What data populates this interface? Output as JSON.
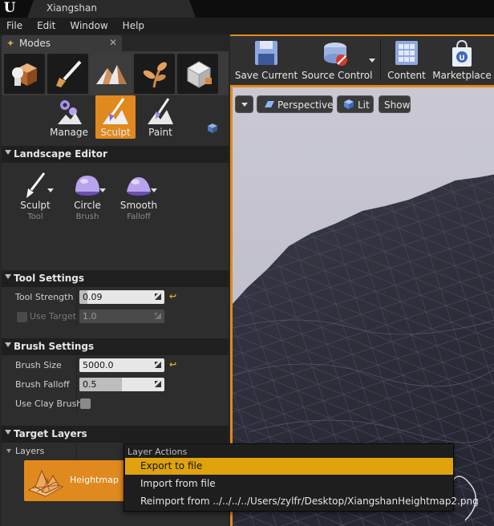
{
  "window": {
    "title": "Xiangshan"
  },
  "menubar": {
    "items": [
      "File",
      "Edit",
      "Window",
      "Help"
    ]
  },
  "modes_panel": {
    "tab_label": "Modes",
    "mode_icons": [
      "place-icon",
      "paint-icon",
      "landscape-icon",
      "foliage-icon",
      "geometry-icon"
    ],
    "active_mode": "landscape",
    "tool_modes": [
      {
        "label": "Manage",
        "icon": "manage-icon"
      },
      {
        "label": "Sculpt",
        "icon": "sculpt-icon",
        "active": true
      },
      {
        "label": "Paint",
        "icon": "paint-mode-icon"
      }
    ]
  },
  "landscape_editor": {
    "title": "Landscape Editor",
    "tools": [
      {
        "title": "Sculpt",
        "sub": "Tool"
      },
      {
        "title": "Circle",
        "sub": "Brush"
      },
      {
        "title": "Smooth",
        "sub": "Falloff"
      }
    ]
  },
  "tool_settings": {
    "title": "Tool Settings",
    "tool_strength": {
      "label": "Tool Strength",
      "value": "0.09",
      "fraction": 0.09
    },
    "use_target": {
      "label": "Use Target",
      "value": "1.0",
      "checked": false
    }
  },
  "brush_settings": {
    "title": "Brush Settings",
    "brush_size": {
      "label": "Brush Size",
      "value": "5000.0"
    },
    "brush_falloff": {
      "label": "Brush Falloff",
      "value": "0.5",
      "fraction": 0.5
    },
    "use_clay_brush": {
      "label": "Use Clay Brush",
      "checked": false
    }
  },
  "target_layers": {
    "title": "Target Layers",
    "layers_label": "Layers",
    "layer": {
      "name": "Heightmap"
    }
  },
  "toolbar": {
    "buttons": [
      {
        "label": "Save Current",
        "icon": "save-icon"
      },
      {
        "label": "Source Control",
        "icon": "source-control-icon"
      },
      {
        "label": "Content",
        "icon": "content-icon"
      },
      {
        "label": "Marketplace",
        "icon": "marketplace-icon"
      }
    ]
  },
  "viewport": {
    "perspective": "Perspective",
    "lit": "Lit",
    "show": "Show"
  },
  "context_menu": {
    "header": "Layer Actions",
    "items": [
      {
        "label": "Export to file",
        "highlighted": true
      },
      {
        "label": "Import from file"
      },
      {
        "label": "Reimport from ../../../../Users/zylfr/Desktop/XiangshanHeightmap2.png"
      }
    ]
  },
  "colors": {
    "accent_orange": "#e0891e",
    "menu_highlight": "#e0a30e",
    "panel_bg": "#2d2d2d",
    "section_header_bg": "#1f1f1f"
  }
}
